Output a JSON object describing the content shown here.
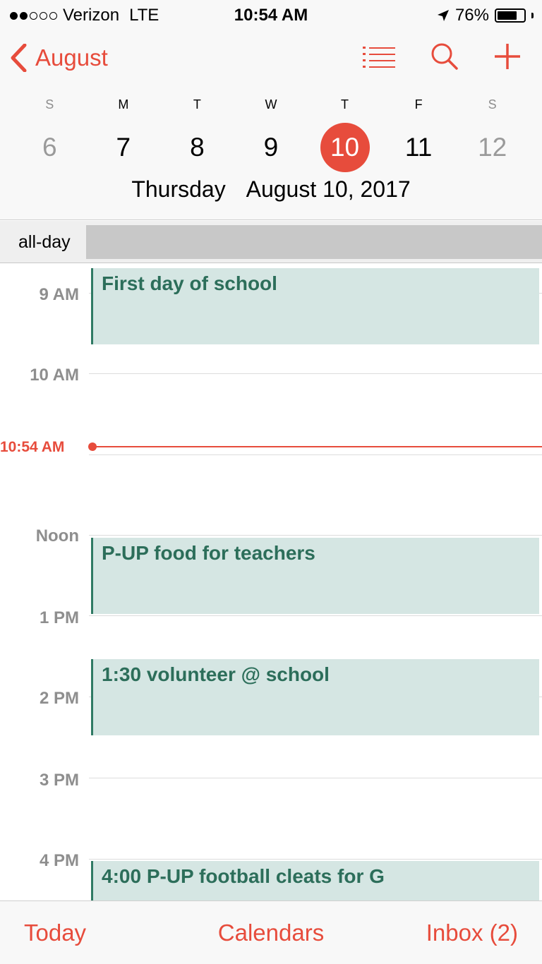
{
  "status_bar": {
    "carrier": "Verizon",
    "network": "LTE",
    "time": "10:54 AM",
    "battery_percent_label": "76%",
    "battery_level": 0.76,
    "signal_strength": 2
  },
  "nav": {
    "back_label": "August",
    "icons": [
      "list-icon",
      "search-icon",
      "plus-icon"
    ]
  },
  "week": {
    "letters": [
      "S",
      "M",
      "T",
      "W",
      "T",
      "F",
      "S"
    ],
    "days": [
      "6",
      "7",
      "8",
      "9",
      "10",
      "11",
      "12"
    ],
    "selected_index": 4
  },
  "selected_date": {
    "weekday": "Thursday",
    "full": "August 10, 2017"
  },
  "allday_label": "all-day",
  "hours": [
    "9 AM",
    "10 AM",
    "Noon",
    "1 PM",
    "2 PM",
    "3 PM",
    "4 PM"
  ],
  "now_label": "10:54 AM",
  "events": [
    {
      "title": "First day of school"
    },
    {
      "title": "P-UP food for teachers"
    },
    {
      "title": "1:30 volunteer @ school"
    },
    {
      "title": "4:00 P-UP football cleats for G"
    }
  ],
  "tabbar": {
    "today": "Today",
    "calendars": "Calendars",
    "inbox": "Inbox (2)"
  },
  "colors": {
    "accent": "#e74c3c",
    "event_bg": "#d5e6e3",
    "event_text": "#2c6e5a"
  }
}
